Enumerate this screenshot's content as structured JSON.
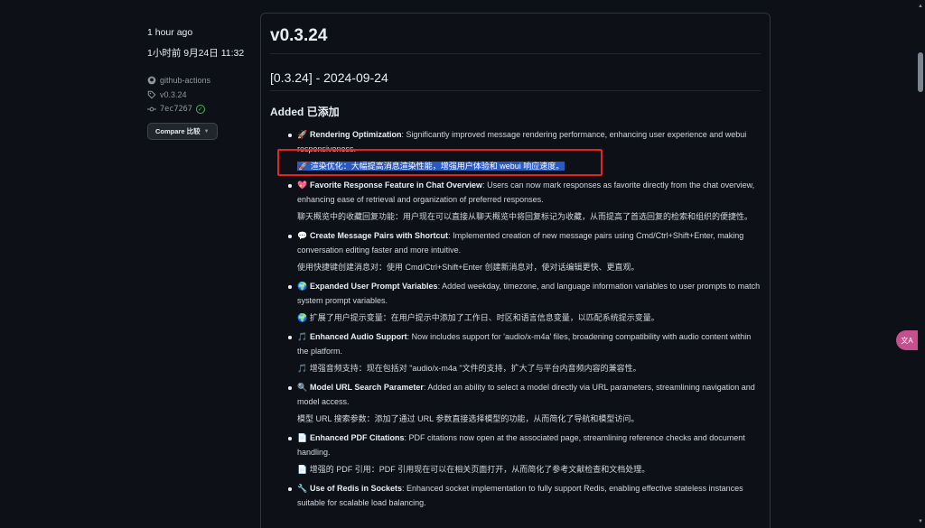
{
  "sidebar": {
    "time_ago": "1 hour ago",
    "time_zh": "1小时前 9月24日 11:32",
    "author": "github-actions",
    "tag": "v0.3.24",
    "commit": "7ec7267",
    "compare_label": "Compare 比较"
  },
  "release": {
    "version": "v0.3.24",
    "subtitle": "[0.3.24] - 2024-09-24",
    "section": "Added 已添加",
    "items": [
      {
        "emoji": "🚀",
        "title": "Rendering Optimization",
        "desc": ": Significantly improved message rendering performance, enhancing user experience and webui responsiveness.",
        "zh": "🚀 渲染优化：大幅提高消息渲染性能，增强用户体验和 webui 响应速度。"
      },
      {
        "emoji": "💖",
        "title": "Favorite Response Feature in Chat Overview",
        "desc": ": Users can now mark responses as favorite directly from the chat overview, enhancing ease of retrieval and organization of preferred responses.",
        "zh": "聊天概览中的收藏回复功能：用户现在可以直接从聊天概览中将回复标记为收藏，从而提高了首选回复的检索和组织的便捷性。"
      },
      {
        "emoji": "💬",
        "title": "Create Message Pairs with Shortcut",
        "desc": ": Implemented creation of new message pairs using Cmd/Ctrl+Shift+Enter, making conversation editing faster and more intuitive.",
        "zh": "使用快捷键创建消息对：使用 Cmd/Ctrl+Shift+Enter 创建新消息对，使对话编辑更快、更直观。"
      },
      {
        "emoji": "🌍",
        "title": "Expanded User Prompt Variables",
        "desc": ": Added weekday, timezone, and language information variables to user prompts to match system prompt variables.",
        "zh": "🌍 扩展了用户提示变量：在用户提示中添加了工作日、时区和语言信息变量，以匹配系统提示变量。"
      },
      {
        "emoji": "🎵",
        "title": "Enhanced Audio Support",
        "desc": ": Now includes support for 'audio/x-m4a' files, broadening compatibility with audio content within the platform.",
        "zh": "🎵 增强音频支持：现在包括对 \"audio/x-m4a \"文件的支持，扩大了与平台内音频内容的兼容性。"
      },
      {
        "emoji": "🔍",
        "title": "Model URL Search Parameter",
        "desc": ": Added an ability to select a model directly via URL parameters, streamlining navigation and model access.",
        "zh": "模型 URL 搜索参数：添加了通过 URL 参数直接选择模型的功能，从而简化了导航和模型访问。"
      },
      {
        "emoji": "📄",
        "title": "Enhanced PDF Citations",
        "desc": ": PDF citations now open at the associated page, streamlining reference checks and document handling.",
        "zh": "📄 增强的 PDF 引用：PDF 引用现在可以在相关页面打开，从而简化了参考文献检查和文档处理。"
      },
      {
        "emoji": "🔧",
        "title": "Use of Redis in Sockets",
        "desc": ": Enhanced socket implementation to fully support Redis, enabling effective stateless instances suitable for scalable load balancing.",
        "zh": ""
      }
    ]
  },
  "float_button_label": "文A"
}
